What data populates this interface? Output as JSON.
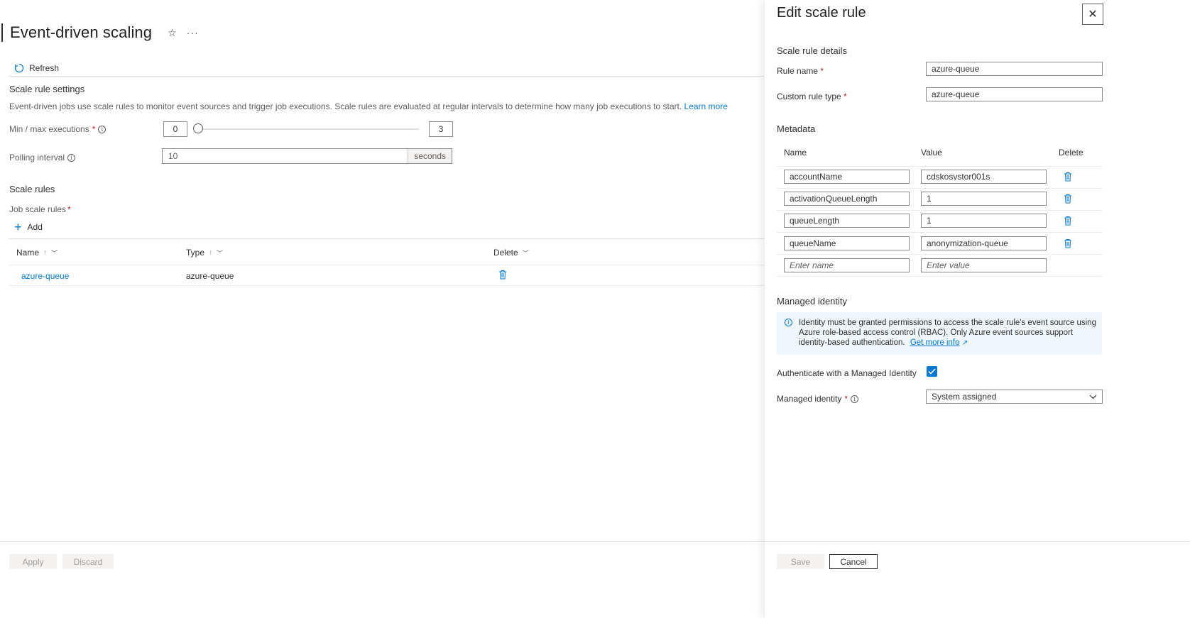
{
  "page": {
    "title": "Event-driven scaling",
    "toolbar": {
      "refresh_label": "Refresh"
    },
    "scale_rule_settings": {
      "heading": "Scale rule settings",
      "description": "Event-driven jobs use scale rules to monitor event sources and trigger job executions. Scale rules are evaluated at regular intervals to determine how many job executions to start.",
      "learn_more": "Learn more",
      "min_max_label": "Min / max executions",
      "min_value": "0",
      "max_value": "3",
      "polling_label": "Polling interval",
      "polling_value": "10",
      "polling_unit": "seconds"
    },
    "scale_rules": {
      "heading": "Scale rules",
      "job_scale_rules_label": "Job scale rules",
      "add_label": "Add",
      "columns": {
        "name": "Name",
        "type": "Type",
        "delete": "Delete"
      },
      "rows": [
        {
          "name": "azure-queue",
          "type": "azure-queue"
        }
      ]
    },
    "footer": {
      "apply": "Apply",
      "discard": "Discard"
    }
  },
  "panel": {
    "title": "Edit scale rule",
    "details_heading": "Scale rule details",
    "rule_name_label": "Rule name",
    "rule_name_value": "azure-queue",
    "custom_type_label": "Custom rule type",
    "custom_type_value": "azure-queue",
    "metadata_heading": "Metadata",
    "metadata_columns": {
      "name": "Name",
      "value": "Value",
      "delete": "Delete"
    },
    "metadata_rows": [
      {
        "name": "accountName",
        "value": "cdskosvstor001s"
      },
      {
        "name": "activationQueueLength",
        "value": "1"
      },
      {
        "name": "queueLength",
        "value": "1"
      },
      {
        "name": "queueName",
        "value": "anonymization-queue"
      }
    ],
    "new_row": {
      "name_placeholder": "Enter name",
      "value_placeholder": "Enter value"
    },
    "managed_identity_heading": "Managed identity",
    "info_text": "Identity must be granted permissions to access the scale rule's event source using Azure role-based access control (RBAC). Only Azure event sources support identity-based authentication.",
    "info_link": "Get more info",
    "auth_label": "Authenticate with a Managed Identity",
    "auth_checked": true,
    "identity_label": "Managed identity",
    "identity_value": "System assigned",
    "save_label": "Save",
    "cancel_label": "Cancel"
  },
  "colors": {
    "accent": "#0078d4",
    "required": "#a4262c"
  }
}
